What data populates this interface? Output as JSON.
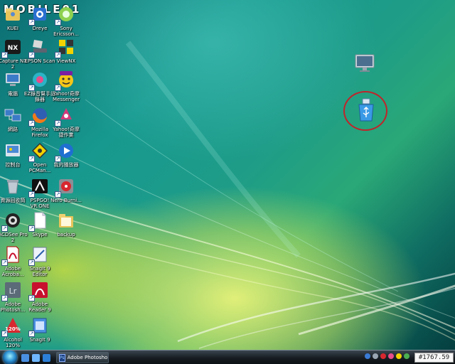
{
  "watermark": "MOBILE01",
  "desktop_icons": [
    {
      "label": "KUEI",
      "icon": "user-folder-icon",
      "shortcut": false
    },
    {
      "label": "Dreye",
      "icon": "dreye-icon",
      "shortcut": true
    },
    {
      "label": "Sony Ericsson...",
      "icon": "sony-ericsson-icon",
      "shortcut": true
    },
    {
      "label": "Capture NX 2",
      "icon": "capture-nx2-icon",
      "shortcut": true
    },
    {
      "label": "EPSON Scan",
      "icon": "epson-scan-icon",
      "shortcut": true
    },
    {
      "label": "ViewNX",
      "icon": "viewnx-icon",
      "shortcut": true
    },
    {
      "label": "電腦",
      "icon": "computer-icon",
      "shortcut": false
    },
    {
      "label": "EZ錄音幫手記錄器",
      "icon": "ez-recorder-icon",
      "shortcut": true
    },
    {
      "label": "Yahoo!奇摩 Messenger",
      "icon": "yahoo-messenger-icon",
      "shortcut": true
    },
    {
      "label": "網路",
      "icon": "network-icon",
      "shortcut": false
    },
    {
      "label": "Mozilla Firefox",
      "icon": "firefox-icon",
      "shortcut": true
    },
    {
      "label": "Yahoo!奇摩 捷作業",
      "icon": "yahoo-widget-icon",
      "shortcut": true
    },
    {
      "label": "控制台",
      "icon": "control-panel-icon",
      "shortcut": false
    },
    {
      "label": "Open PCMan...",
      "icon": "pcman-icon",
      "shortcut": true
    },
    {
      "label": "我的播放器",
      "icon": "media-player-icon",
      "shortcut": true
    },
    {
      "label": "資源回收筒",
      "icon": "recycle-bin-icon",
      "shortcut": false
    },
    {
      "label": "PSPGO! VR.ONE",
      "icon": "pspgo-icon",
      "shortcut": true
    },
    {
      "label": "Nero Burni...",
      "icon": "nero-icon",
      "shortcut": true
    },
    {
      "label": "ACDSee Pro 2",
      "icon": "acdsee-icon",
      "shortcut": true
    },
    {
      "label": "Skype",
      "icon": "document-icon",
      "shortcut": true
    },
    {
      "label": "backup",
      "icon": "folder-icon",
      "shortcut": false
    },
    {
      "label": "Adobe Acroba...",
      "icon": "acrobat-icon",
      "shortcut": true
    },
    {
      "label": "SnagIt 9 Editor",
      "icon": "snagit-editor-icon",
      "shortcut": true
    },
    {
      "label": "Adobe Photosh...",
      "icon": "lightroom-icon",
      "shortcut": true
    },
    {
      "label": "Adobe Reader 9",
      "icon": "adobe-reader-icon",
      "shortcut": true
    },
    {
      "label": "Alcohol 120%",
      "icon": "alcohol-icon",
      "shortcut": true
    },
    {
      "label": "SnagIt 9",
      "icon": "snagit-icon",
      "shortcut": true
    }
  ],
  "colors": {
    "highlight": "#c0242a",
    "taskbar": "#151b20"
  },
  "taskbar": {
    "task_button_label": "Adobe Photoshop ...",
    "clock_badge": "#1767.59"
  }
}
